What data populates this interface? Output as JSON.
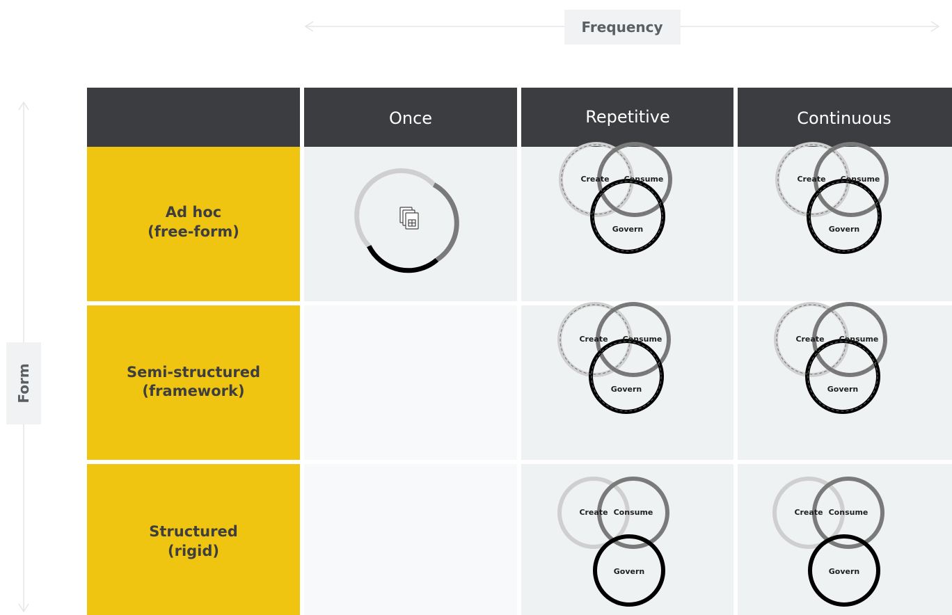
{
  "axes": {
    "horizontal_label": "Frequency",
    "vertical_label": "Form"
  },
  "columns": [
    "Once",
    "Repetitive",
    "Continuous"
  ],
  "rows": [
    {
      "line1": "Ad hoc",
      "line2": "(free-form)"
    },
    {
      "line1": "Semi-structured",
      "line2": "(framework)"
    },
    {
      "line1": "Structured",
      "line2": "(rigid)"
    }
  ],
  "circle_labels": {
    "create": "Create",
    "consume": "Consume",
    "govern": "Govern"
  },
  "once_icon": "report-pages-icon",
  "colors": {
    "header": "#3c3d40",
    "row_header": "#f0c511",
    "create_ring": "#cfcfcf",
    "consume_ring": "#7a7a7a",
    "govern_ring": "#000000"
  }
}
